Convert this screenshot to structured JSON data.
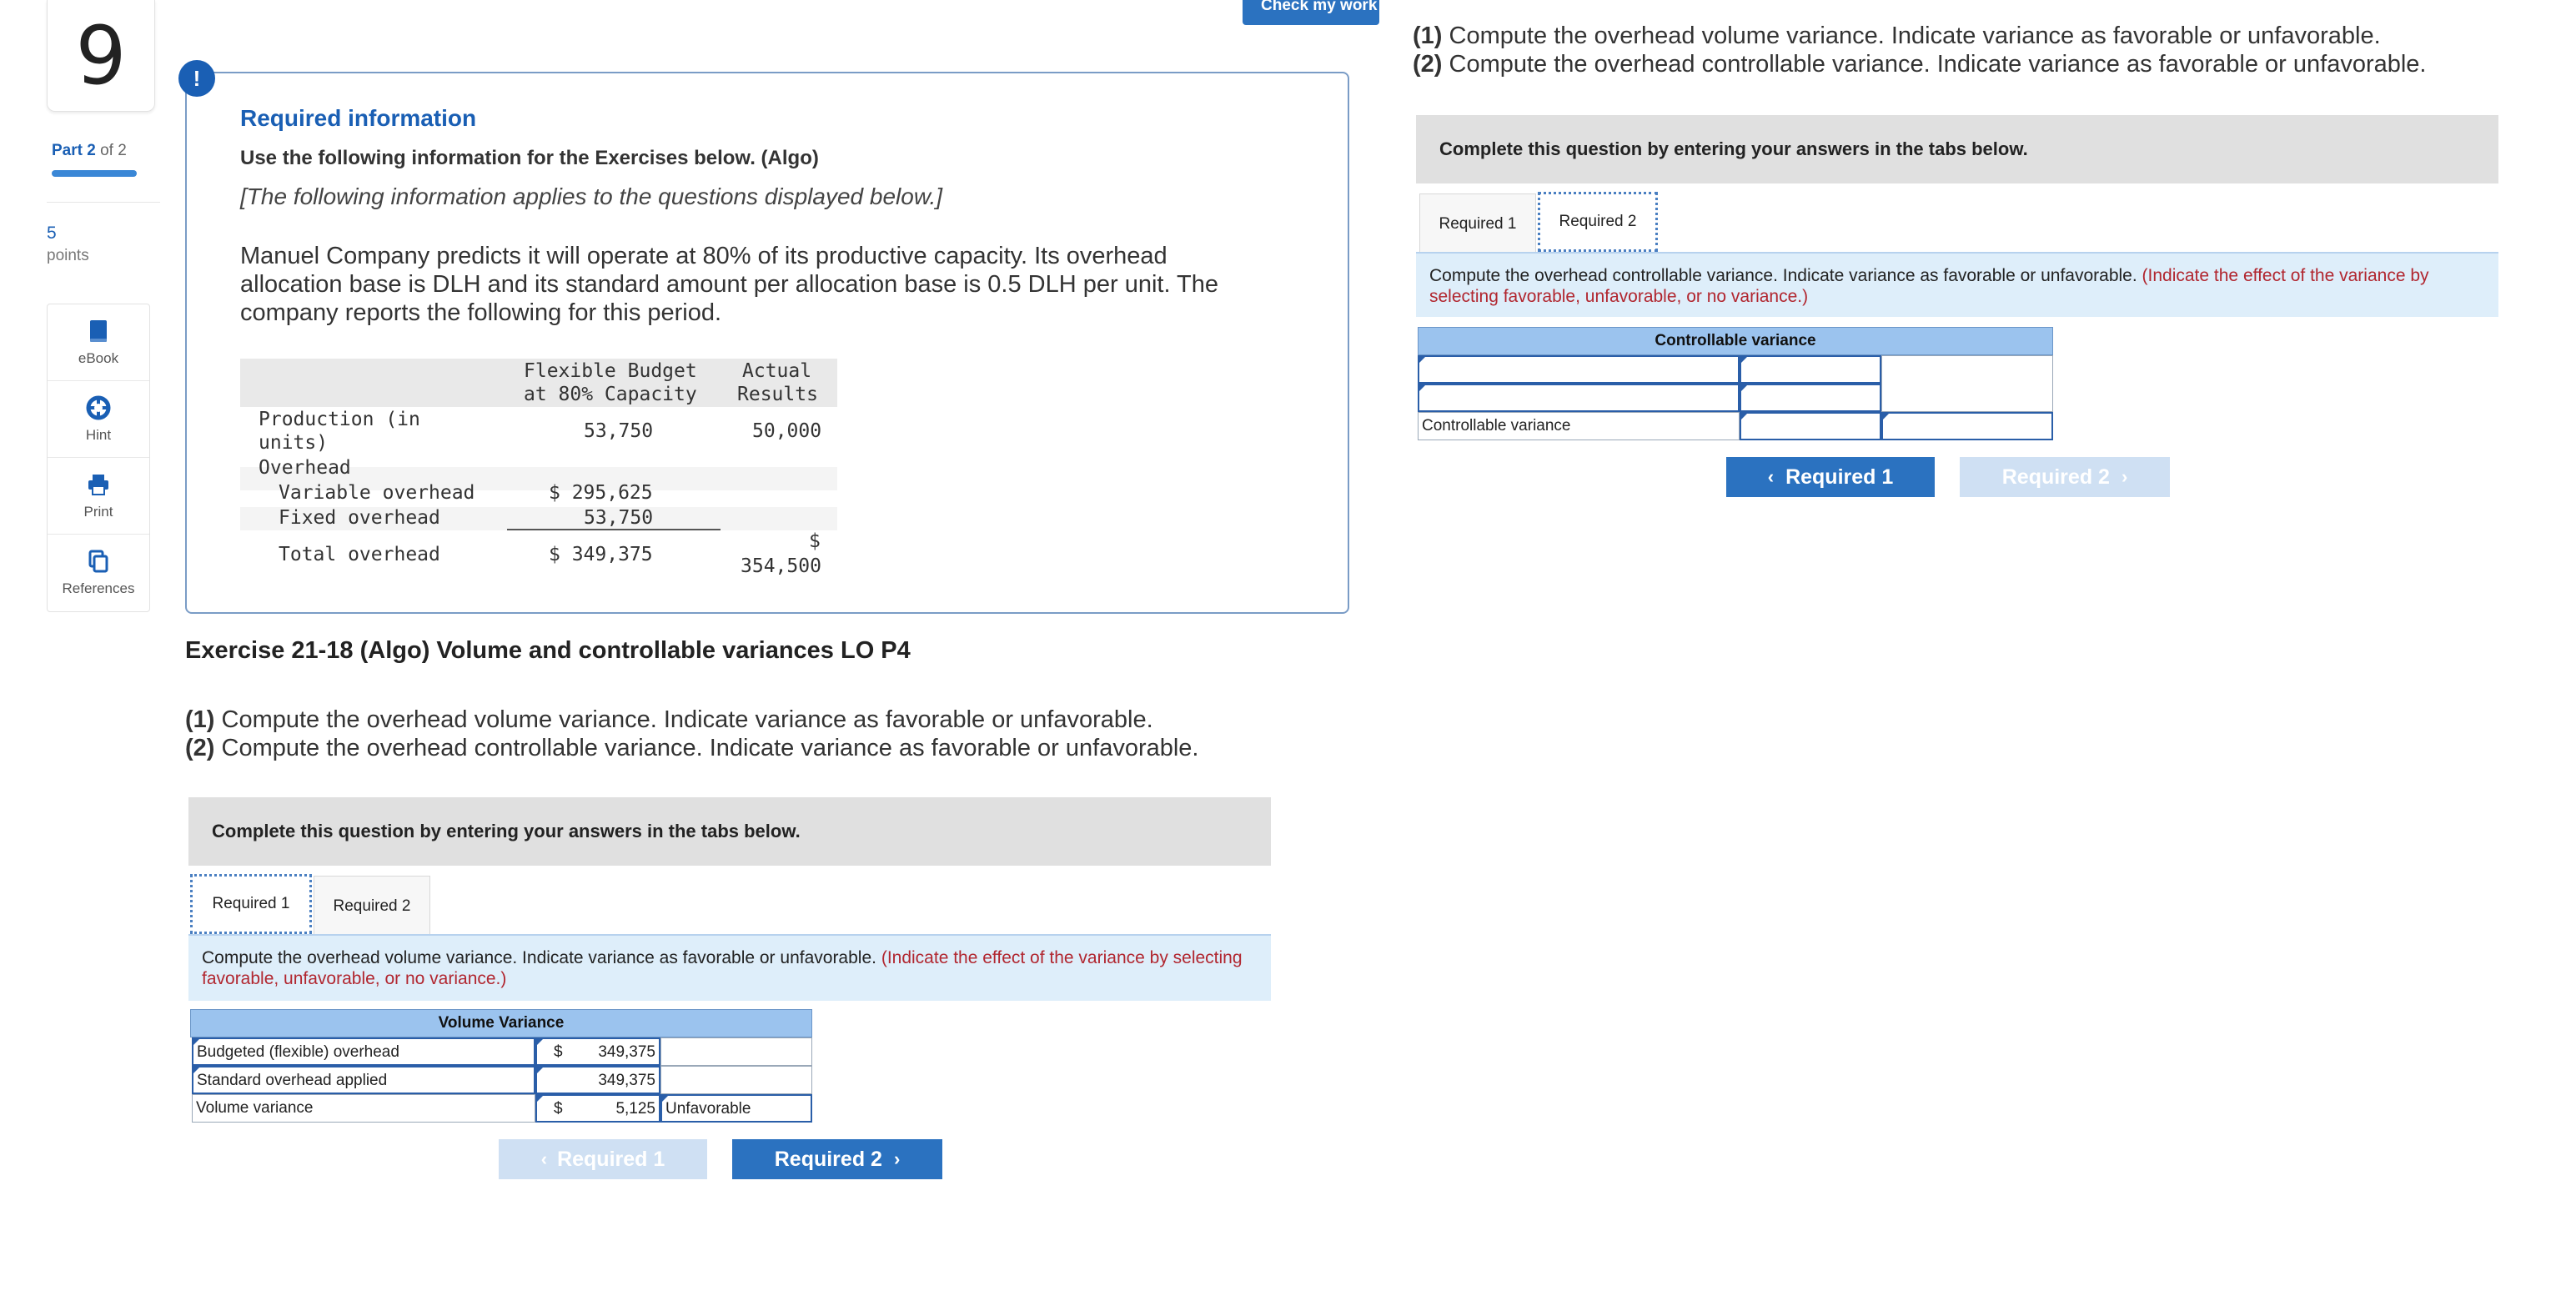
{
  "question_number": "9",
  "part": {
    "current": "Part 2",
    "suffix": " of 2"
  },
  "points": {
    "value": "5",
    "label": "points"
  },
  "tools": [
    {
      "label": "eBook",
      "icon": "book-icon"
    },
    {
      "label": "Hint",
      "icon": "lifebuoy-icon"
    },
    {
      "label": "Print",
      "icon": "printer-icon"
    },
    {
      "label": "References",
      "icon": "copy-icon"
    }
  ],
  "check_work_label": "Check my work",
  "required_info": {
    "icon": "!",
    "title": "Required information",
    "use_line": "Use the following information for the Exercises below. (Algo)",
    "italic_line": "[The following information applies to the questions displayed below.]",
    "paragraph": "Manuel Company predicts it will operate at 80% of its productive capacity. Its overhead allocation base is DLH and its standard amount per allocation base is 0.5 DLH per unit. The company reports the following for this period.",
    "table": {
      "header_flexible_1": "Flexible Budget",
      "header_flexible_2": "at 80% Capacity",
      "header_actual_1": "Actual",
      "header_actual_2": "Results",
      "production_label_1": "Production (in",
      "production_label_2": "units)",
      "production_flexible": "53,750",
      "production_actual": "50,000",
      "overhead_label": "Overhead",
      "variable_label": "Variable overhead",
      "variable_flexible": "$ 295,625",
      "fixed_label": "Fixed overhead",
      "fixed_flexible": "53,750",
      "total_label": "Total overhead",
      "total_flexible": "$ 349,375",
      "total_actual_1": "$",
      "total_actual_2": "354,500"
    }
  },
  "exercise_title": "Exercise 21-18 (Algo) Volume and controllable variances LO P4",
  "instructions": {
    "line1_num": "(1)",
    "line1": " Compute the overhead volume variance. Indicate variance as favorable or unfavorable.",
    "line2_num": "(2)",
    "line2": " Compute the overhead controllable variance. Indicate variance as favorable or unfavorable."
  },
  "complete_banner": "Complete this question by entering your answers in the tabs below.",
  "tabs": [
    "Required 1",
    "Required 2"
  ],
  "required1": {
    "prompt": "Compute the overhead volume variance. Indicate variance as favorable or unfavorable.",
    "prompt_red": "(Indicate the effect of the variance by selecting favorable, unfavorable, or no variance.)",
    "grid_title": "Volume Variance",
    "rows": [
      {
        "label": "Budgeted (flexible) overhead",
        "symbol": "$",
        "value": "349,375",
        "effect": ""
      },
      {
        "label": "Standard overhead applied",
        "symbol": "",
        "value": "349,375",
        "effect": ""
      },
      {
        "label": "Volume variance",
        "symbol": "$",
        "value": "5,125",
        "effect": "Unfavorable"
      }
    ],
    "prev_label": "Required 1",
    "next_label": "Required 2"
  },
  "required2": {
    "prompt": "Compute the overhead controllable variance. Indicate variance as favorable or unfavorable.",
    "prompt_red": "(Indicate the effect of the variance by selecting favorable, unfavorable, or no variance.)",
    "grid_title": "Controllable variance",
    "rows": [
      {
        "label": "",
        "value": "",
        "effect": ""
      },
      {
        "label": "",
        "value": "",
        "effect": ""
      },
      {
        "label": "Controllable variance",
        "value": "",
        "effect": ""
      }
    ],
    "prev_label": "Required 1",
    "next_label": "Required 2"
  },
  "colors": {
    "brand_blue": "#1a5fb4",
    "button_blue": "#2b72c0",
    "prompt_red": "#b1262f",
    "grid_header": "#9bc3ee"
  }
}
